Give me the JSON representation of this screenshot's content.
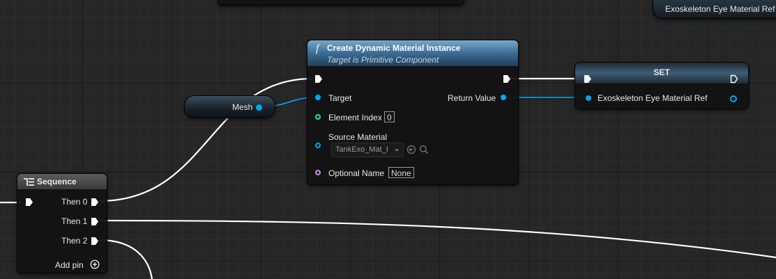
{
  "create_node": {
    "title": "Create Dynamic Material Instance",
    "subtitle": "Target is Primitive Component",
    "func_icon": "f",
    "target_label": "Target",
    "element_index_label": "Element Index",
    "element_index_value": "0",
    "source_material_label": "Source Material",
    "source_material_value": "TankExo_Mat_I",
    "optional_name_label": "Optional Name",
    "optional_name_value": "None",
    "return_value_label": "Return Value"
  },
  "set_node": {
    "title": "SET",
    "var_label": "Exoskeleton Eye Material Ref"
  },
  "top_right_node": {
    "label": "Exoskeleton Eye Material Ref"
  },
  "mesh_node": {
    "label": "Mesh"
  },
  "sequence_node": {
    "title": "Sequence",
    "outputs": [
      "Then 0",
      "Then 1",
      "Then 2"
    ],
    "add_pin_label": "Add pin"
  },
  "colors": {
    "object_pin": "#00a8f4",
    "int_pin": "#1fe3af",
    "name_pin": "#c88cf0",
    "exec_pin": "#ffffff",
    "function_header": "#3a6d94"
  }
}
